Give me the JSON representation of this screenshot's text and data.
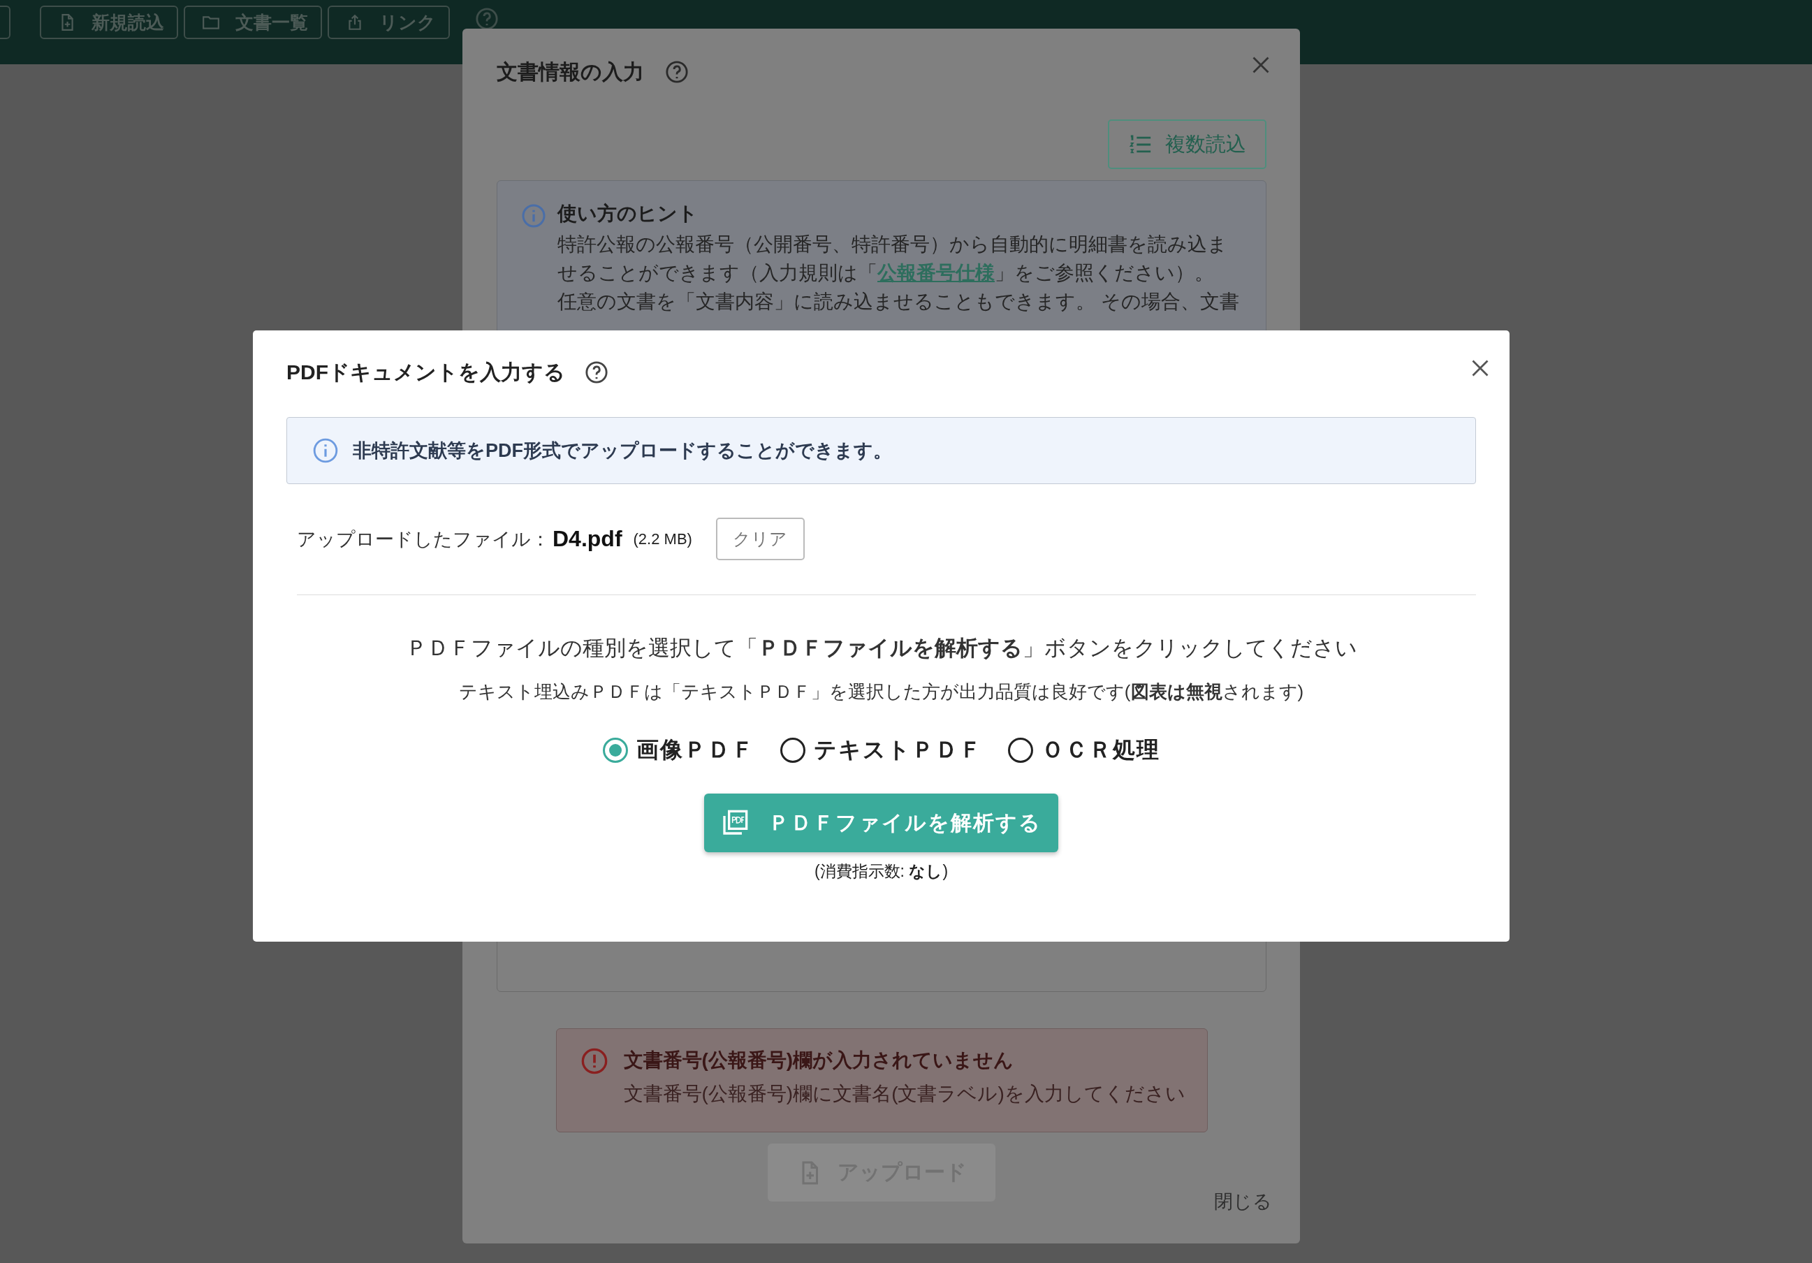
{
  "toolbar": {
    "buttons": [
      {
        "label": "新規読込"
      },
      {
        "label": "文書一覧"
      },
      {
        "label": "リンク"
      }
    ]
  },
  "background_dialog": {
    "title": "文書情報の入力",
    "bulk_button": "複数読込",
    "hint": {
      "title": "使い方のヒント",
      "paragraphs": [
        {
          "text": "特許公報の公報番号（公開番号、特許番号）から自動的に明細書を読み込ませることができます（入力規則は「",
          "link": "公報番号仕様",
          "after": "」をご参照ください）。"
        },
        {
          "text": "任意の文書を「文書内容」に読み込ませることもできます。 その場合、文書"
        }
      ]
    },
    "error": {
      "title": "文書番号(公報番号)欄が入力されていません",
      "message": "文書番号(公報番号)欄に文書名(文書ラベル)を入力してください"
    },
    "upload_button": {
      "label": "アップロード",
      "disabled": true
    },
    "close_link": "閉じる"
  },
  "pdf_dialog": {
    "title": "PDFドキュメントを入力する",
    "info": "非特許文献等をPDF形式でアップロードすることができます。",
    "file": {
      "label": "アップロードしたファイル：",
      "name": "D4.pdf",
      "size": "(2.2 MB)"
    },
    "clear_button": "クリア",
    "instruction": "ＰＤＦファイルの種別を選択して「**ＰＤＦファイルを解析する**」ボタンをクリックしてください",
    "note": "テキスト埋込みＰＤＦは「テキストＰＤＦ」を選択した方が出力品質は良好です(**図表は無視**されます)",
    "pdf_types": [
      {
        "label": "画像ＰＤＦ",
        "selected": true
      },
      {
        "label": "テキストＰＤＦ",
        "selected": false
      },
      {
        "label": "ＯＣＲ処理",
        "selected": false
      }
    ],
    "analyze_button": "ＰＤＦファイルを解析する",
    "usage_note": "(消費指示数: **なし**)"
  }
}
